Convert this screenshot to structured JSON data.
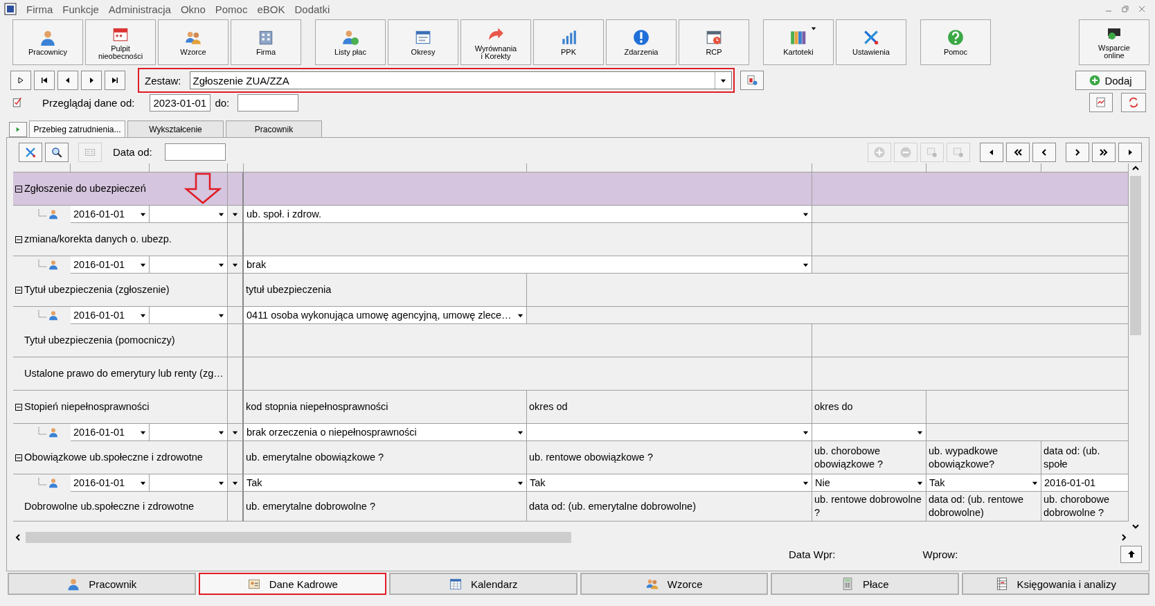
{
  "menu_bar": {
    "items": [
      "Firma",
      "Funkcje",
      "Administracja",
      "Okno",
      "Pomoc",
      "eBOK",
      "Dodatki"
    ]
  },
  "toolbar": {
    "groups": [
      [
        {
          "label": "Pracownicy"
        },
        {
          "label": "Pulpit\nnieobecności"
        },
        {
          "label": "Wzorce"
        },
        {
          "label": "Firma"
        }
      ],
      [
        {
          "label": "Listy płac"
        },
        {
          "label": "Okresy"
        },
        {
          "label": "Wyrównania\ni Korekty"
        },
        {
          "label": "PPK"
        },
        {
          "label": "Zdarzenia"
        },
        {
          "label": "RCP"
        }
      ],
      [
        {
          "label": "Kartoteki",
          "has_menu": true
        },
        {
          "label": "Ustawienia"
        }
      ],
      [
        {
          "label": "Pomoc"
        }
      ]
    ],
    "support": {
      "label": "Wsparcie\nonline"
    }
  },
  "zestaw": {
    "label": "Zestaw:",
    "value": "Zgłoszenie ZUA/ZZA",
    "annotated": true
  },
  "add_button": {
    "label": "Dodaj"
  },
  "browse": {
    "label": "Przeglądaj dane od:",
    "from": "2023-01-01",
    "to_label": "do:"
  },
  "tabs": [
    {
      "label": "Przebieg zatrudnienia...",
      "selected": true
    },
    {
      "label": "Wykształcenie",
      "selected": false
    },
    {
      "label": "Pracownik",
      "selected": false
    }
  ],
  "panel": {
    "date_label": "Data od:"
  },
  "groups": [
    {
      "kind": "merged",
      "label": "Zgłoszenie do ubezpieczeń",
      "expanded": true,
      "selected": true,
      "arrow": true,
      "child": {
        "date": "2016-01-01",
        "side_dropdown": true,
        "fields": [
          {
            "kind": "dropdown",
            "value": "ub. społ. i zdrow."
          }
        ]
      }
    },
    {
      "kind": "merged",
      "label": "zmiana/korekta danych o. ubezp.",
      "expanded": true,
      "selected": false,
      "child": {
        "date": "2016-01-01",
        "side_dropdown": true,
        "fields": [
          {
            "kind": "dropdown",
            "value": "brak"
          }
        ]
      }
    },
    {
      "kind": "split",
      "label": "Tytuł ubezpieczenia (zgłoszenie)",
      "expanded": true,
      "selected": false,
      "cells": [
        {
          "text": "tytuł ubezpieczenia"
        }
      ],
      "child": {
        "date": "2016-01-01",
        "side_dropdown": false,
        "fields": [
          {
            "kind": "dropdown",
            "value": "0411 osoba wykonująca umowę agencyjną, umowę zlece…"
          }
        ]
      }
    },
    {
      "kind": "merged",
      "label": "Tytuł ubezpieczenia (pomocniczy)",
      "selected": false
    },
    {
      "kind": "merged",
      "label": "Ustalone prawo do emerytury lub renty (zg…",
      "selected": false
    },
    {
      "kind": "table",
      "label": "Stopień niepełnosprawności",
      "expanded": true,
      "selected": false,
      "cells": [
        {
          "text": "kod stopnia niepełnosprawności"
        },
        {
          "text": "okres od"
        },
        {
          "text": "okres do"
        }
      ],
      "child": {
        "date": "2016-01-01",
        "side_dropdown": true,
        "fields": [
          {
            "kind": "dropdown",
            "value": "brak orzeczenia o niepełnosprawności"
          },
          {
            "kind": "dropdown"
          },
          {
            "kind": "dropdown"
          }
        ]
      }
    },
    {
      "kind": "table",
      "label": "Obowiązkowe ub.społeczne i zdrowotne",
      "expanded": true,
      "selected": false,
      "cells": [
        {
          "text": "ub. emerytalne obowiązkowe ?"
        },
        {
          "text": "ub. rentowe obowiązkowe ?"
        },
        {
          "text": "ub. chorobowe obowiązkowe ?"
        },
        {
          "text": "ub. wypadkowe obowiązkowe?"
        },
        {
          "text": "data od: (ub. społe"
        }
      ],
      "child": {
        "date": "2016-01-01",
        "side_dropdown": true,
        "fields": [
          {
            "kind": "dropdown",
            "value": "Tak"
          },
          {
            "kind": "dropdown",
            "value": "Tak"
          },
          {
            "kind": "dropdown",
            "value": "Nie"
          },
          {
            "kind": "dropdown",
            "value": "Tak"
          },
          {
            "kind": "text",
            "value": "2016-01-01"
          }
        ]
      }
    },
    {
      "kind": "table",
      "label": "Dobrowolne ub.społeczne i zdrowotne",
      "selected": false,
      "cells": [
        {
          "text": "ub. emerytalne dobrowolne ?"
        },
        {
          "text": "data od: (ub. emerytalne dobrowolne)"
        },
        {
          "text": "ub. rentowe dobrowolne ?"
        },
        {
          "text": "data od: (ub. rentowe dobrowolne)"
        },
        {
          "text": "ub. chorobowe dobrowolne ?"
        }
      ]
    }
  ],
  "footer": {
    "data_wpr_label": "Data Wpr:",
    "wprow_label": "Wprow:"
  },
  "bottom_tabs": [
    {
      "label": "Pracownik",
      "selected": false,
      "annotated": false
    },
    {
      "label": "Dane Kadrowe",
      "selected": true,
      "annotated": true
    },
    {
      "label": "Kalendarz",
      "selected": false,
      "annotated": false
    },
    {
      "label": "Wzorce",
      "selected": false,
      "annotated": false
    },
    {
      "label": "Płace",
      "selected": false,
      "annotated": false
    },
    {
      "label": "Księgowania i analizy",
      "selected": false,
      "annotated": false
    }
  ]
}
